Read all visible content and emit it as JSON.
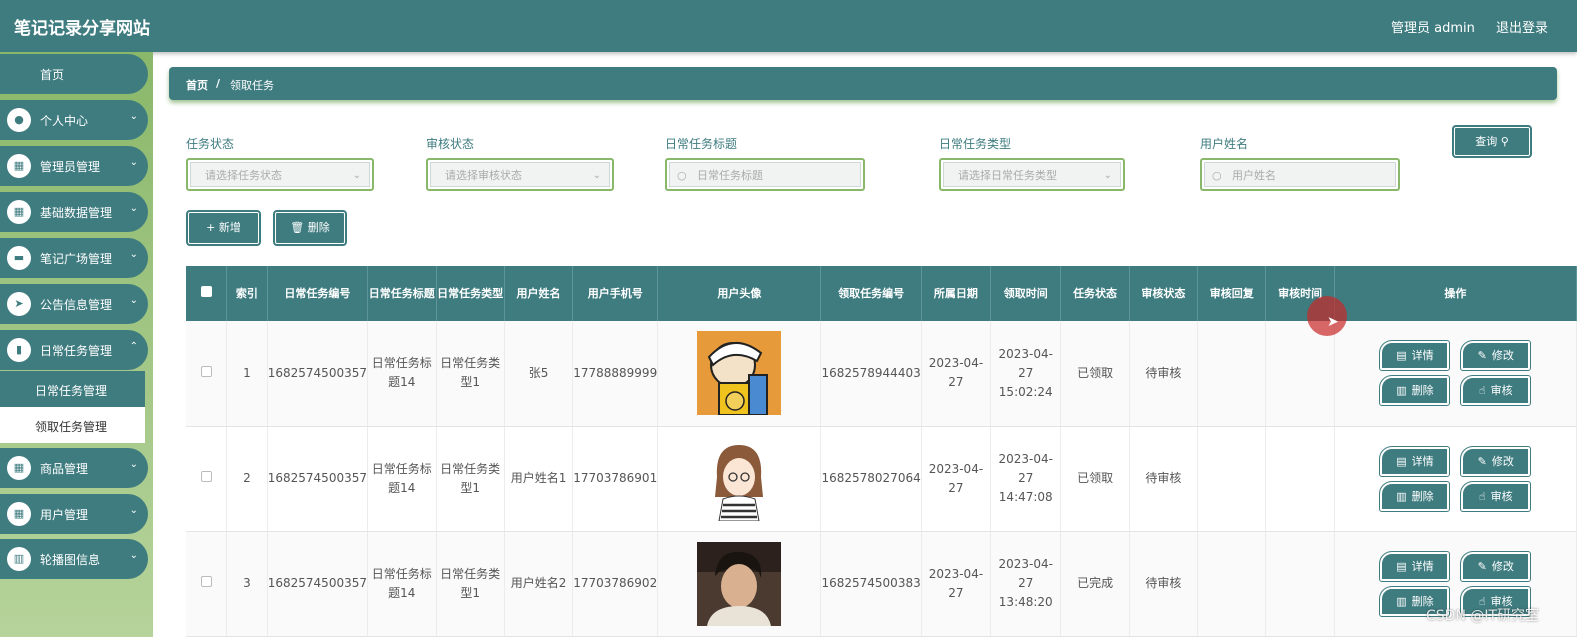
{
  "header": {
    "title": "笔记记录分享网站",
    "admin": "管理员 admin",
    "logout": "退出登录"
  },
  "sidebar": {
    "home": "首页",
    "items": [
      {
        "label": "个人中心",
        "icon": "user-icon"
      },
      {
        "label": "管理员管理",
        "icon": "grid-icon"
      },
      {
        "label": "基础数据管理",
        "icon": "grid-icon"
      },
      {
        "label": "笔记广场管理",
        "icon": "monitor-icon"
      },
      {
        "label": "公告信息管理",
        "icon": "send-icon"
      },
      {
        "label": "日常任务管理",
        "icon": "book-icon"
      }
    ],
    "subitems": [
      "日常任务管理",
      "领取任务管理"
    ],
    "items2": [
      {
        "label": "商品管理",
        "icon": "grid-icon"
      },
      {
        "label": "用户管理",
        "icon": "grid-icon"
      },
      {
        "label": "轮播图信息",
        "icon": "chart-icon"
      }
    ]
  },
  "breadcrumb": {
    "home": "首页",
    "sep": "/",
    "current": "领取任务"
  },
  "filters": {
    "task_status": {
      "label": "任务状态",
      "placeholder": "请选择任务状态"
    },
    "audit_status": {
      "label": "审核状态",
      "placeholder": "请选择审核状态"
    },
    "task_title": {
      "label": "日常任务标题",
      "placeholder": "日常任务标题"
    },
    "task_type": {
      "label": "日常任务类型",
      "placeholder": "请选择日常任务类型"
    },
    "user_name": {
      "label": "用户姓名",
      "placeholder": "用户姓名"
    },
    "query": "查询"
  },
  "toolbar": {
    "add": "新增",
    "delete": "删除"
  },
  "table": {
    "headers": [
      "索引",
      "日常任务编号",
      "日常任务标题",
      "日常任务类型",
      "用户姓名",
      "用户手机号",
      "用户头像",
      "领取任务编号",
      "所属日期",
      "领取时间",
      "任务状态",
      "审核状态",
      "审核回复",
      "审核时间",
      "操作"
    ],
    "rows": [
      {
        "index": "1",
        "task_no": "1682574500357",
        "title": "日常任务标题14",
        "type": "日常任务类型1",
        "user": "张5",
        "phone": "17788889999",
        "claim_no": "1682578944403",
        "date": "2023-04-27",
        "claim_time": "2023-04-27 15:02:24",
        "task_status": "已领取",
        "audit_status": "待审核",
        "reply": "",
        "audit_time": ""
      },
      {
        "index": "2",
        "task_no": "1682574500357",
        "title": "日常任务标题14",
        "type": "日常任务类型1",
        "user": "用户姓名1",
        "phone": "17703786901",
        "claim_no": "1682578027064",
        "date": "2023-04-27",
        "claim_time": "2023-04-27 14:47:08",
        "task_status": "已领取",
        "audit_status": "待审核",
        "reply": "",
        "audit_time": ""
      },
      {
        "index": "3",
        "task_no": "1682574500357",
        "title": "日常任务标题14",
        "type": "日常任务类型1",
        "user": "用户姓名2",
        "phone": "17703786902",
        "claim_no": "1682574500383",
        "date": "2023-04-27",
        "claim_time": "2023-04-27 13:48:20",
        "task_status": "已完成",
        "audit_status": "待审核",
        "reply": "",
        "audit_time": ""
      }
    ],
    "actions": {
      "detail": "详情",
      "edit": "修改",
      "delete": "删除",
      "audit": "审核"
    }
  },
  "watermark": "CSDN @IT研究室",
  "colors": {
    "primary": "#3f7c80",
    "sidebar_green": "#8ab86a"
  }
}
